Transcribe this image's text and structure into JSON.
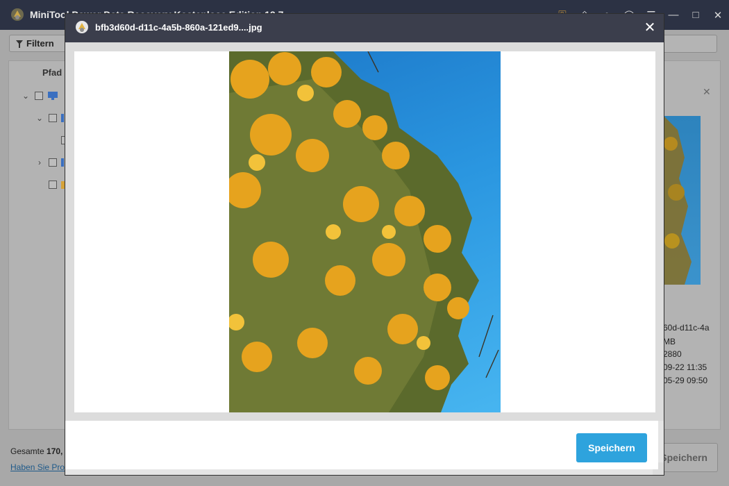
{
  "app": {
    "title": "MiniTool Power Data Recovery Kostenlose Edition 12.7",
    "icons": [
      "key-icon",
      "upload-icon",
      "support-icon",
      "help-icon",
      "menu-icon",
      "minimize-icon",
      "maximize-icon",
      "close-icon"
    ]
  },
  "toolbar": {
    "filter_label": "Filtern"
  },
  "tree": {
    "header": "Pfad"
  },
  "details": {
    "lines": [
      "60d-d11c-4a",
      "MB",
      "2880",
      "09-22 11:35",
      "05-29 09:50"
    ]
  },
  "footer": {
    "total_label": "Gesamte ",
    "total_value": "170,",
    "help_link": "Haben Sie Pro",
    "save_label": "Speichern"
  },
  "preview": {
    "title": "bfb3d60d-d11c-4a5b-860a-121ed9....jpg",
    "close_glyph": "✕",
    "save_label": "Speichern",
    "accent": "#2ea3dd"
  }
}
